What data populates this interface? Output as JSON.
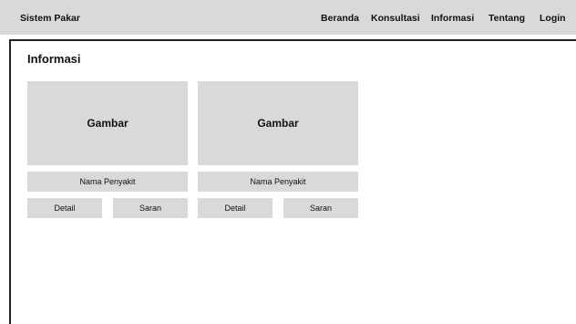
{
  "navbar": {
    "brand": "Sistem Pakar",
    "items": [
      {
        "label": "Beranda"
      },
      {
        "label": "Konsultasi"
      },
      {
        "label": "Informasi"
      },
      {
        "label": "Tentang"
      },
      {
        "label": "Login"
      }
    ]
  },
  "page": {
    "title": "Informasi"
  },
  "cards": [
    {
      "image_label": "Gambar",
      "name": "Nama Penyakit",
      "detail_label": "Detail",
      "saran_label": "Saran"
    },
    {
      "image_label": "Gambar",
      "name": "Nama Penyakit",
      "detail_label": "Detail",
      "saran_label": "Saran"
    }
  ],
  "colors": {
    "placeholder_gray": "#d9d9d9",
    "frame_border": "#222222"
  }
}
